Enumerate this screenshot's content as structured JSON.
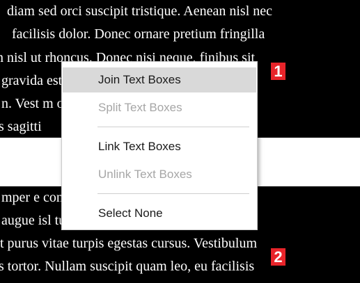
{
  "document": {
    "top_box_lines": [
      "diam sed orci suscipit tristique. Aenean nisl nec",
      "facilisis dolor. Donec ornare pretium fringilla",
      "n nisl ut rhoncus. Donec nisi neque, finibus sit",
      "gravida                                        estie. Phasellus",
      "n. Vest                                        m ornare efficitur",
      "s sagitti"
    ],
    "bottom_box_lines": [
      "mper e                                       consequat eleifend",
      "augue                                        isl turpis, sed",
      "t purus vitae turpis egestas cursus. Vestibulum",
      "s tortor. Nullam suscipit quam leo, eu facilisis",
      "                                                      "
    ]
  },
  "markers": {
    "first": "1",
    "second": "2"
  },
  "context_menu": {
    "join_label": "Join Text Boxes",
    "split_label": "Split Text Boxes",
    "link_label": "Link Text Boxes",
    "unlink_label": "Unlink Text Boxes",
    "select_none_label": "Select None"
  },
  "colors": {
    "text_box_background": "#000000",
    "marker_background": "#e8242a",
    "menu_highlight": "#d9d9d9",
    "disabled_text": "#a6a6a6"
  }
}
